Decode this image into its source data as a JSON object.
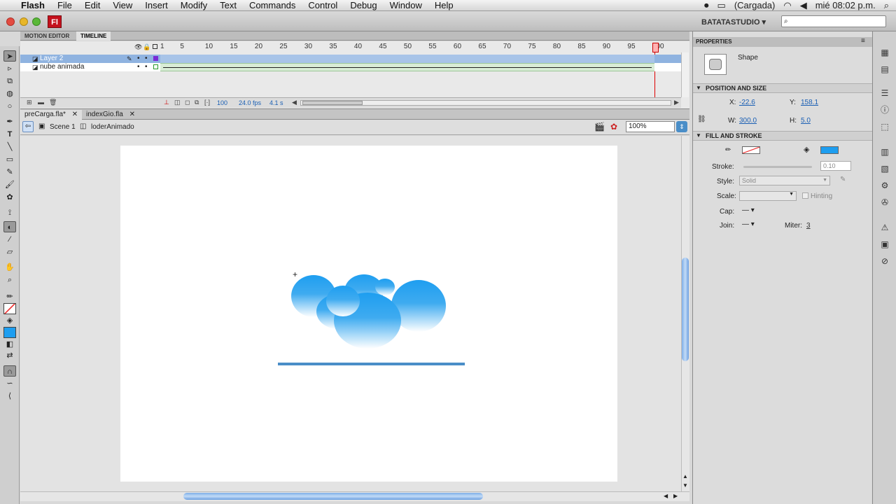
{
  "menubar": {
    "app": "Flash",
    "items": [
      "File",
      "Edit",
      "View",
      "Insert",
      "Modify",
      "Text",
      "Commands",
      "Control",
      "Debug",
      "Window",
      "Help"
    ],
    "battery": "(Cargada)",
    "clock": "mié 08:02 p.m."
  },
  "titlebar": {
    "logo": "Fl",
    "workspace": "BATATASTUDIO ▾",
    "search_placeholder": ""
  },
  "timeline": {
    "tabs": [
      "MOTION EDITOR",
      "TIMELINE"
    ],
    "ruler": [
      "1",
      "5",
      "10",
      "15",
      "20",
      "25",
      "30",
      "35",
      "40",
      "45",
      "50",
      "55",
      "60",
      "65",
      "70",
      "75",
      "80",
      "85",
      "90",
      "95",
      "100"
    ],
    "layers": [
      {
        "name": "Layer 2",
        "selected": true
      },
      {
        "name": "nube animada",
        "selected": false
      }
    ],
    "status": {
      "frame": "100",
      "fps": "24.0 fps",
      "time": "4.1 s"
    }
  },
  "documents": {
    "tabs": [
      "preCarga.fla*",
      "indexGio.fla"
    ]
  },
  "editbar": {
    "scene": "Scene 1",
    "symbol": "loderAnimado",
    "zoom": "100%"
  },
  "properties": {
    "tab": "PROPERTIES",
    "type": "Shape",
    "sections": {
      "pos": "POSITION AND SIZE",
      "fill": "FILL AND STROKE"
    },
    "x_label": "X:",
    "x": "-22.6",
    "y_label": "Y:",
    "y": "158.1",
    "w_label": "W:",
    "w": "300.0",
    "h_label": "H:",
    "h": "5.0",
    "stroke_label": "Stroke:",
    "stroke": "0.10",
    "style_label": "Style:",
    "style": "Solid",
    "scale_label": "Scale:",
    "hinting": "Hinting",
    "cap_label": "Cap:",
    "join_label": "Join:",
    "miter_label": "Miter:",
    "miter": "3"
  },
  "colors": {
    "fill": "#1e9ef0",
    "accent": "#4a8ec8"
  }
}
